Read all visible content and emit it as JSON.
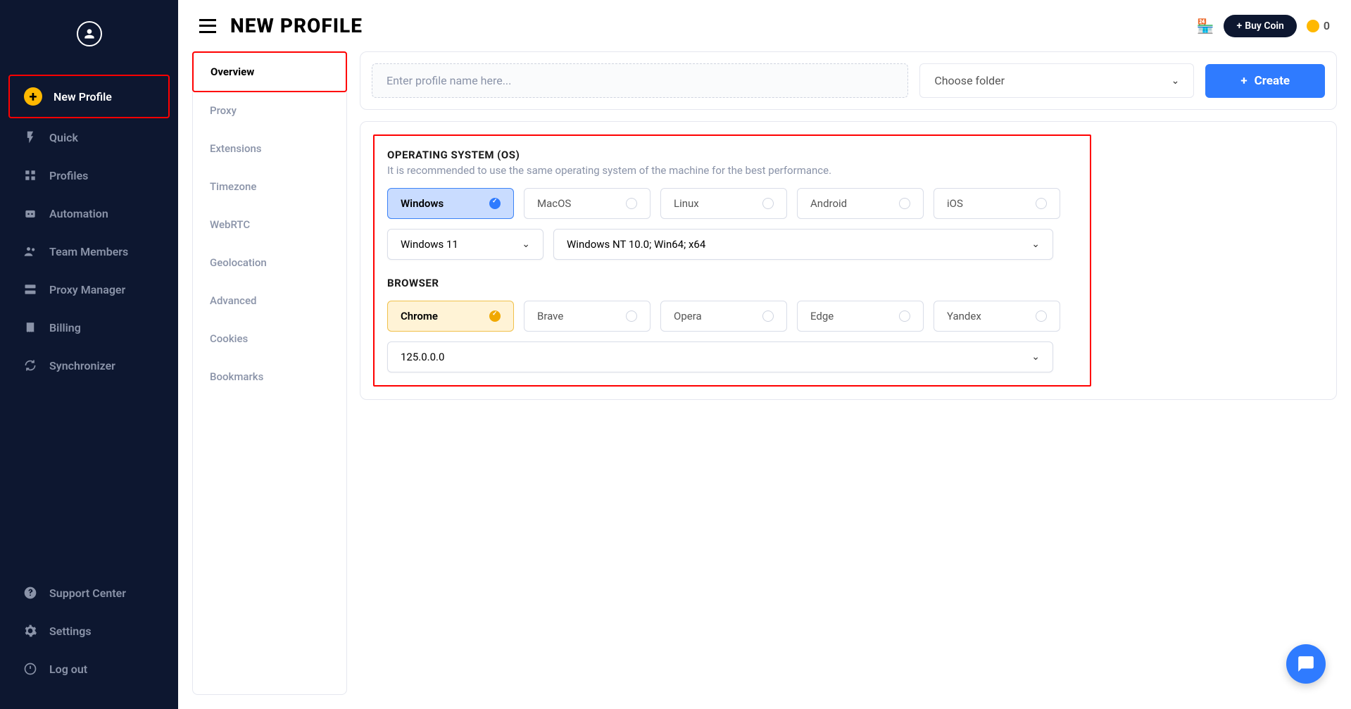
{
  "page_title": "NEW PROFILE",
  "topbar": {
    "buy_coin": "Buy Coin",
    "coin_count": "0"
  },
  "sidebar": {
    "items": [
      {
        "label": "New Profile",
        "icon": "plus"
      },
      {
        "label": "Quick",
        "icon": "bolt"
      },
      {
        "label": "Profiles",
        "icon": "grid"
      },
      {
        "label": "Automation",
        "icon": "robot"
      },
      {
        "label": "Team Members",
        "icon": "users"
      },
      {
        "label": "Proxy Manager",
        "icon": "server"
      },
      {
        "label": "Billing",
        "icon": "receipt"
      },
      {
        "label": "Synchronizer",
        "icon": "sync"
      }
    ],
    "bottom": [
      {
        "label": "Support Center",
        "icon": "support"
      },
      {
        "label": "Settings",
        "icon": "gear"
      },
      {
        "label": "Log out",
        "icon": "logout"
      }
    ]
  },
  "subnav": {
    "items": [
      "Overview",
      "Proxy",
      "Extensions",
      "Timezone",
      "WebRTC",
      "Geolocation",
      "Advanced",
      "Cookies",
      "Bookmarks"
    ]
  },
  "form": {
    "profile_name_placeholder": "Enter profile name here...",
    "folder_placeholder": "Choose folder",
    "create_label": "Create"
  },
  "os_section": {
    "title": "OPERATING SYSTEM (OS)",
    "hint": "It is recommended to use the same operating system of the machine for the best performance.",
    "options": [
      "Windows",
      "MacOS",
      "Linux",
      "Android",
      "iOS"
    ],
    "selected": "Windows",
    "version_dropdown": "Windows 11",
    "ua_dropdown": "Windows NT 10.0; Win64; x64"
  },
  "browser_section": {
    "title": "BROWSER",
    "options": [
      "Chrome",
      "Brave",
      "Opera",
      "Edge",
      "Yandex"
    ],
    "selected": "Chrome",
    "version_dropdown": "125.0.0.0"
  }
}
